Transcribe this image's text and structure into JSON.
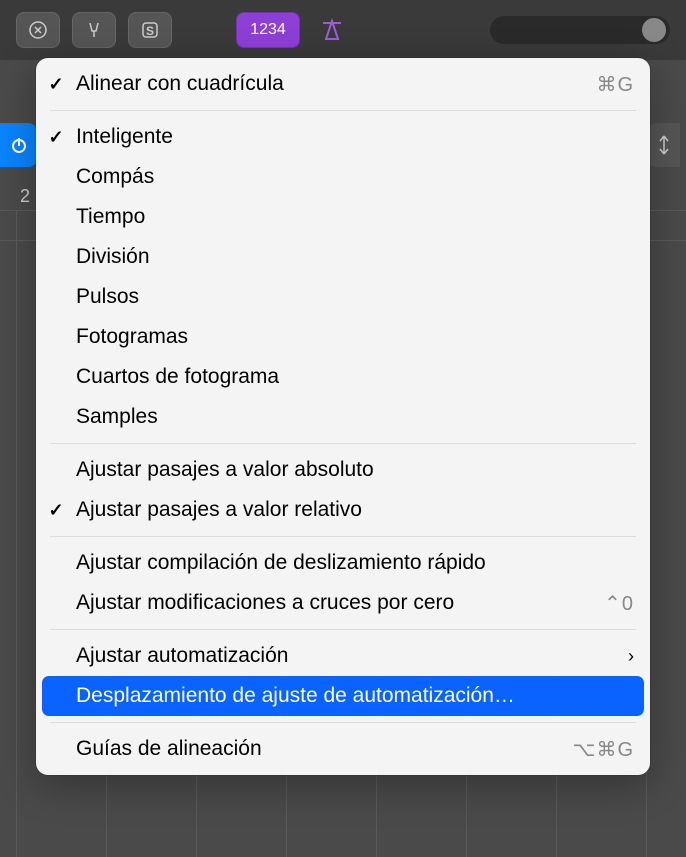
{
  "toolbar": {
    "btn_1234": "1234"
  },
  "ruler": {
    "label": "2"
  },
  "menu": {
    "items": [
      {
        "label": "Alinear con cuadrícula",
        "checked": true,
        "shortcut": "⌘G"
      }
    ],
    "group2": [
      {
        "label": "Inteligente",
        "checked": true
      },
      {
        "label": "Compás"
      },
      {
        "label": "Tiempo"
      },
      {
        "label": "División"
      },
      {
        "label": "Pulsos"
      },
      {
        "label": "Fotogramas"
      },
      {
        "label": "Cuartos de fotograma"
      },
      {
        "label": "Samples"
      }
    ],
    "group3": [
      {
        "label": "Ajustar pasajes a valor absoluto"
      },
      {
        "label": "Ajustar pasajes a valor relativo",
        "checked": true
      }
    ],
    "group4": [
      {
        "label": "Ajustar compilación de deslizamiento rápido"
      },
      {
        "label": "Ajustar modificaciones a cruces por cero",
        "shortcut": "⌃0"
      }
    ],
    "group5": [
      {
        "label": "Ajustar automatización",
        "submenu": true
      },
      {
        "label": "Desplazamiento de ajuste de automatización…",
        "highlighted": true
      }
    ],
    "group6": [
      {
        "label": "Guías de alineación",
        "shortcut": "⌥⌘G"
      }
    ]
  }
}
